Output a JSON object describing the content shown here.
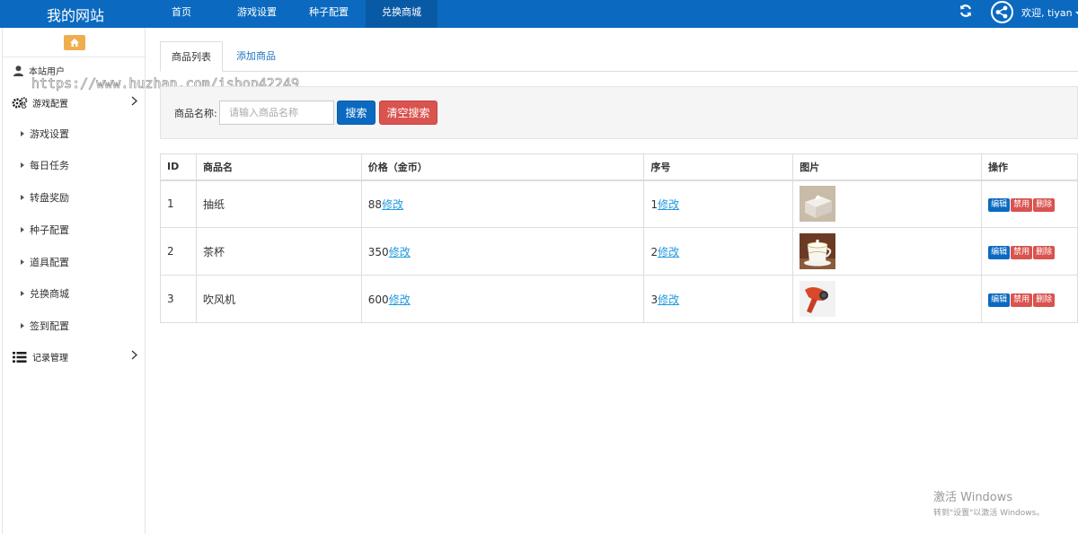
{
  "navbar": {
    "brand": "我的网站",
    "items": [
      {
        "label": "首页"
      },
      {
        "label": "游戏设置"
      },
      {
        "label": "种子配置"
      },
      {
        "label": "兑换商城"
      }
    ],
    "welcome": "欢迎, tiyan",
    "bg_color": "#0b6ac0"
  },
  "sidebar": {
    "user_label": "本站用户",
    "group_game": "游戏配置",
    "sub_items": [
      {
        "label": "游戏设置"
      },
      {
        "label": "每日任务"
      },
      {
        "label": "转盘奖励"
      },
      {
        "label": "种子配置"
      },
      {
        "label": "道具配置"
      },
      {
        "label": "兑换商城"
      },
      {
        "label": "签到配置"
      }
    ],
    "group_records": "记录管理"
  },
  "watermark": "https://www.huzhan.com/ishop42249",
  "tabs": [
    {
      "label": "商品列表"
    },
    {
      "label": "添加商品"
    }
  ],
  "search": {
    "label": "商品名称:",
    "placeholder": "请输入商品名称",
    "search_btn": "搜索",
    "clear_btn": "清空搜索"
  },
  "table": {
    "headers": [
      "ID",
      "商品名",
      "价格（金币）",
      "序号",
      "图片",
      "操作"
    ],
    "rows": [
      {
        "id": "1",
        "name": "抽纸",
        "price": "88",
        "order": "1",
        "image": "tissue-box-image"
      },
      {
        "id": "2",
        "name": "茶杯",
        "price": "350",
        "order": "2",
        "image": "tea-cup-image"
      },
      {
        "id": "3",
        "name": "吹风机",
        "price": "600",
        "order": "3",
        "image": "hair-dryer-image"
      }
    ],
    "edit_link": "修改",
    "btn_edit": "编辑",
    "btn_disable": "禁用",
    "btn_delete": "删除"
  },
  "activation": {
    "line1": "激活 Windows",
    "line2": "转到\"设置\"以激活 Windows。"
  }
}
